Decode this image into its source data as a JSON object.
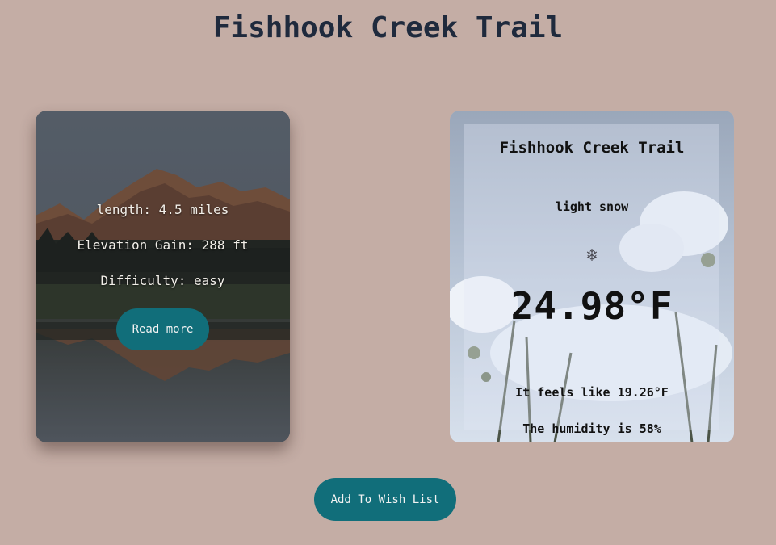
{
  "page": {
    "title": "Fishhook Creek Trail"
  },
  "trail": {
    "length": "length: 4.5 miles",
    "elevation": "Elevation Gain: 288 ft",
    "difficulty": "Difficulty: easy",
    "read_more_label": "Read more"
  },
  "weather": {
    "name": "Fishhook Creek Trail",
    "description": "light snow",
    "icon": "snowflake-icon",
    "icon_glyph": "❄",
    "temperature": "24.98°F",
    "feels_like": "It feels like 19.26°F",
    "humidity": "The humidity is 58%"
  },
  "actions": {
    "wish_list_label": "Add To Wish List"
  },
  "colors": {
    "background": "#c4ada5",
    "title": "#1f2a3d",
    "button": "#116e7a"
  }
}
